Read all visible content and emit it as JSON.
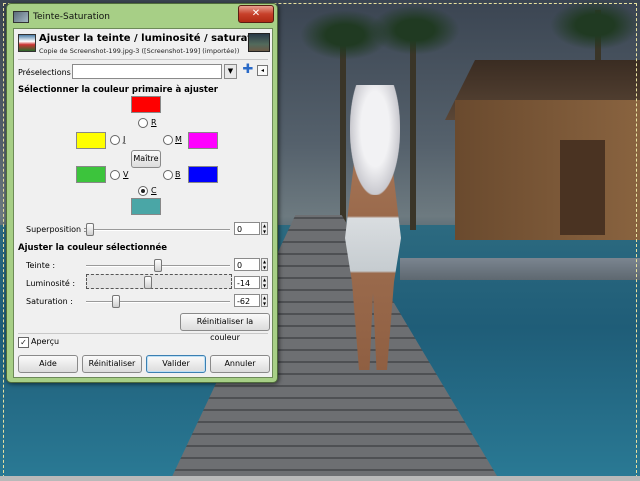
{
  "window": {
    "title": "Teinte-Saturation",
    "close_label": "✕"
  },
  "header": {
    "title": "Ajuster la teinte / luminosité / saturation",
    "subtitle": "Copie de Screenshot-199.jpg-3 ([Screenshot-199] (importée))"
  },
  "presets": {
    "label": "Préselections :",
    "value": "",
    "add_icon": "plus-icon",
    "menu_icon": "menu-arrow-icon"
  },
  "primary_color": {
    "section_title": "Sélectionner la couleur primaire à ajuster",
    "master_label": "Maître",
    "selected": "C",
    "items": [
      {
        "key": "R",
        "label": "R",
        "color": "#ff0000"
      },
      {
        "key": "J",
        "label": "J",
        "color": "#ffff00"
      },
      {
        "key": "M",
        "label": "M",
        "color": "#ff00ff"
      },
      {
        "key": "V",
        "label": "V",
        "color": "#3cc43c"
      },
      {
        "key": "B",
        "label": "B",
        "color": "#0000ff"
      },
      {
        "key": "C",
        "label": "C",
        "color": "#4aa6a6"
      }
    ]
  },
  "overlap": {
    "label": "Superposition :",
    "value": "0",
    "min": 0,
    "max": 100
  },
  "adjust": {
    "section_title": "Ajuster la couleur sélectionnée",
    "hue": {
      "label": "Teinte :",
      "value": "0",
      "num": 0,
      "min": -180,
      "max": 180
    },
    "lightness": {
      "label": "Luminosité :",
      "value": "-14",
      "num": -14,
      "min": -100,
      "max": 100
    },
    "saturation": {
      "label": "Saturation :",
      "value": "-62",
      "num": -62,
      "min": -100,
      "max": 100
    },
    "reset_color_label": "Réinitialiser la couleur"
  },
  "preview": {
    "label": "Aperçu",
    "checked": true
  },
  "buttons": {
    "help": "Aide",
    "reset": "Réinitialiser",
    "ok": "Valider",
    "cancel": "Annuler"
  }
}
